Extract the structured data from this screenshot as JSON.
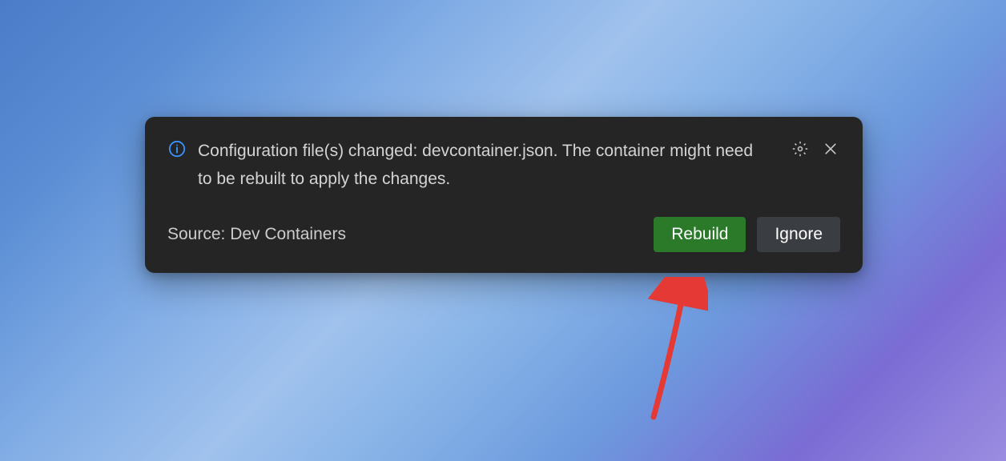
{
  "notification": {
    "message": "Configuration file(s) changed: devcontainer.json. The container might need to be rebuilt to apply the changes.",
    "source": "Source: Dev Containers",
    "actions": {
      "primary": "Rebuild",
      "secondary": "Ignore"
    }
  },
  "colors": {
    "primary_button": "#2a7a2a",
    "secondary_button": "#3a3d41",
    "info_icon": "#3794ff",
    "annotation_arrow": "#e53935"
  }
}
